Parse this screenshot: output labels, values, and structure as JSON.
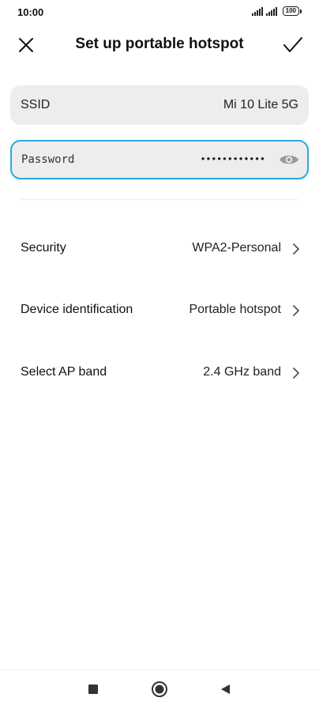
{
  "status_bar": {
    "time": "10:00",
    "battery": "100"
  },
  "header": {
    "title": "Set up portable hotspot"
  },
  "ssid": {
    "label": "SSID",
    "value": "Mi 10 Lite 5G"
  },
  "password": {
    "label": "Password",
    "masked_value": "••••••••••••"
  },
  "settings": [
    {
      "label": "Security",
      "value": "WPA2-Personal"
    },
    {
      "label": "Device identification",
      "value": "Portable hotspot"
    },
    {
      "label": "Select AP band",
      "value": "2.4 GHz band"
    }
  ],
  "colors": {
    "accent": "#2ba6e3",
    "field_bg": "#ededed"
  },
  "icons": {
    "close": "close-icon",
    "confirm": "check-icon",
    "password_toggle": "eye-icon",
    "chevron": "chevron-right-icon"
  }
}
